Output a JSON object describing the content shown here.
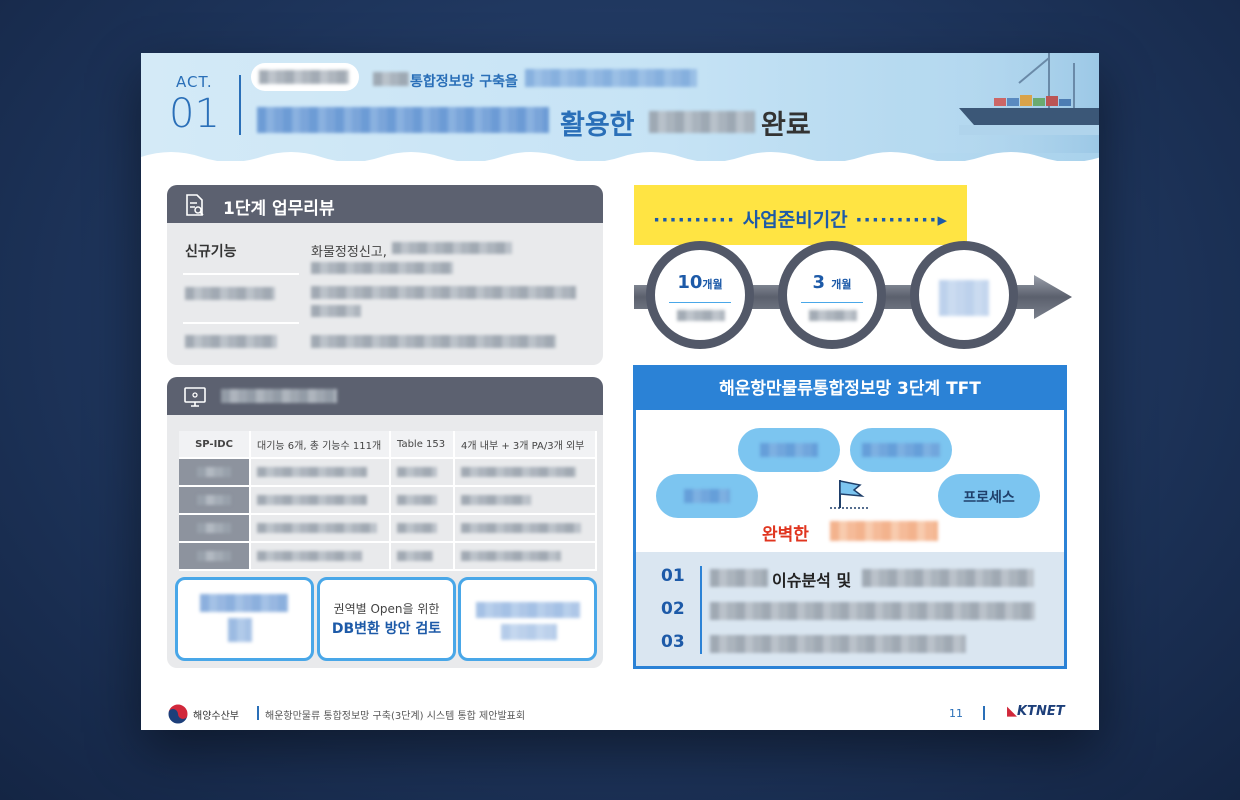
{
  "header": {
    "act_label": "ACT.",
    "act_number": "01",
    "subtitle": "통합정보망 구축을",
    "title_highlight": "활용한",
    "title_end": "완료"
  },
  "stage1_card": {
    "title": "1단계 업무리뷰",
    "row1_label": "신규기능",
    "row1_text": "화물정정신고,"
  },
  "table_card": {
    "header_row": [
      "SP-IDC",
      "대기능 6개, 총 기능수 111개",
      "Table 153",
      "4개 내부 + 3개 PA/3개 외부"
    ]
  },
  "bottom_boxes": {
    "middle_line1": "권역별 Open을 위한",
    "middle_line2": "DB변환 방안 검토"
  },
  "timeline": {
    "banner": "사업준비기간",
    "circle1_num": "10",
    "circle1_unit": "개월",
    "circle2_num": "3",
    "circle2_unit": "개월"
  },
  "tft": {
    "title": "해운항만물류통합정보망 3단계 TFT",
    "bubble_process": "프로세스",
    "perfect_label": "완벽한",
    "items": [
      "01",
      "02",
      "03"
    ],
    "item1_text": "이슈분석 및"
  },
  "footer": {
    "ministry": "해양수산부",
    "project": "해운항만물류 통합정보망 구축(3단계) 시스템 통합 제안발표회",
    "page": "11",
    "company": "KTNET"
  },
  "colors": {
    "accent_blue": "#2a6fb8",
    "tft_blue": "#2b82d6",
    "banner_yellow": "#ffe443",
    "card_header": "#5c6170",
    "highlight_red": "#e0351f"
  }
}
